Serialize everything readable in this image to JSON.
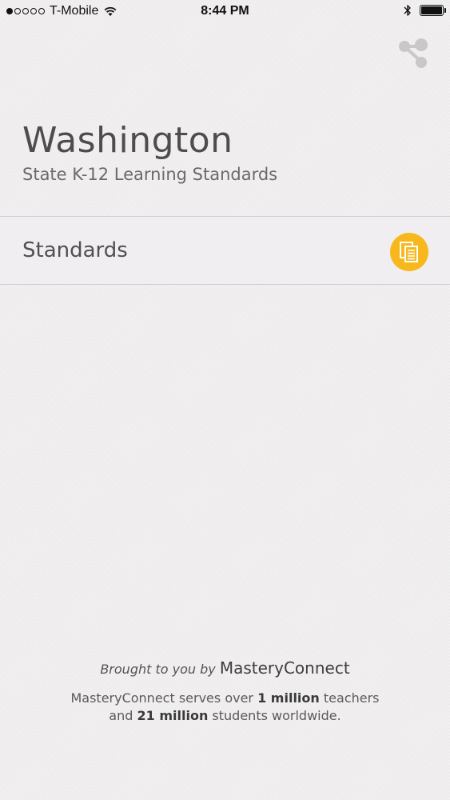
{
  "status_bar": {
    "carrier": "T-Mobile",
    "time": "8:44 PM",
    "signal_bars_filled": 1,
    "signal_bars_total": 5,
    "battery_level": 1.0
  },
  "header": {
    "title": "Washington",
    "subtitle": "State K-12 Learning Standards",
    "share_icon": "share-icon"
  },
  "list": {
    "items": [
      {
        "label": "Standards",
        "icon": "documents-icon",
        "icon_color": "#f6b81c"
      }
    ]
  },
  "footer": {
    "brought_by": "Brought to you by",
    "brand": "MasteryConnect",
    "stats_line1_prefix": "MasteryConnect serves over",
    "stats_line1_bold": "1 million",
    "stats_line1_suffix": "teachers",
    "stats_line2_prefix": "and",
    "stats_line2_bold": "21 million",
    "stats_line2_suffix": "students worldwide."
  },
  "colors": {
    "background": "#efeded",
    "accent": "#f6b81c",
    "text": "#4d4d4d"
  }
}
